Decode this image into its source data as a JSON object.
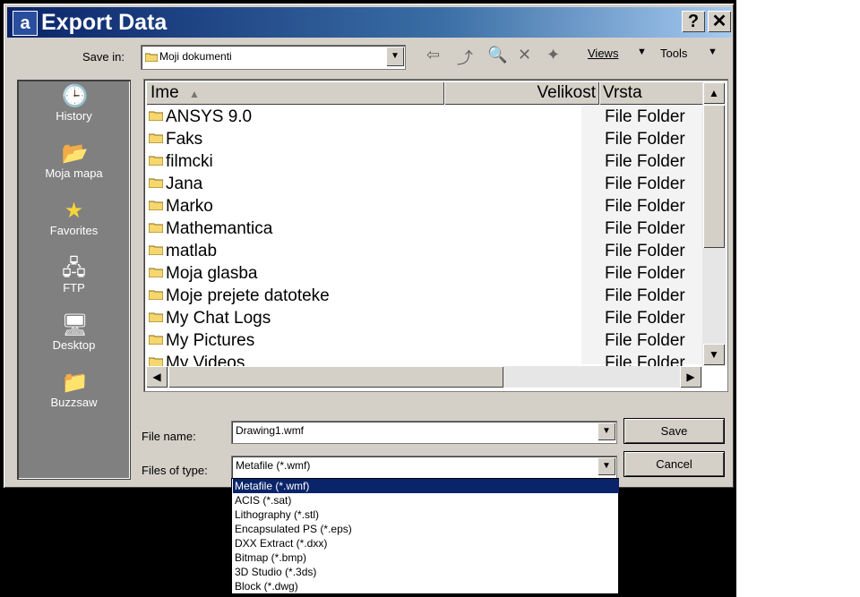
{
  "window": {
    "title": "Export Data",
    "help_label": "?",
    "close_label": "✕"
  },
  "toolbar": {
    "save_in_label": "Save in:",
    "save_in_value": "Moji dokumenti",
    "views_label": "Views",
    "tools_label": "Tools"
  },
  "places": [
    {
      "label": "History",
      "icon": "history-icon"
    },
    {
      "label": "Moja mapa",
      "icon": "folder-icon"
    },
    {
      "label": "Favorites",
      "icon": "star-icon"
    },
    {
      "label": "FTP",
      "icon": "ftp-icon"
    },
    {
      "label": "Desktop",
      "icon": "desktop-icon"
    },
    {
      "label": "Buzzsaw",
      "icon": "buzzsaw-icon"
    }
  ],
  "list": {
    "columns": {
      "name": "Ime",
      "size": "Velikost",
      "type": "Vrsta"
    },
    "rows": [
      {
        "name": "ANSYS 9.0",
        "type": "File Folder"
      },
      {
        "name": "Faks",
        "type": "File Folder"
      },
      {
        "name": "filmcki",
        "type": "File Folder"
      },
      {
        "name": "Jana",
        "type": "File Folder"
      },
      {
        "name": "Marko",
        "type": "File Folder"
      },
      {
        "name": "Mathemantica",
        "type": "File Folder"
      },
      {
        "name": "matlab",
        "type": "File Folder"
      },
      {
        "name": "Moja glasba",
        "type": "File Folder"
      },
      {
        "name": "Moje prejete datoteke",
        "type": "File Folder"
      },
      {
        "name": "My Chat Logs",
        "type": "File Folder"
      },
      {
        "name": "My Pictures",
        "type": "File Folder"
      },
      {
        "name": "My Videos",
        "type": "File Folder"
      }
    ]
  },
  "form": {
    "file_name_label": "File name:",
    "file_name_value": "Drawing1.wmf",
    "file_type_label": "Files of type:",
    "file_type_value": "Metafile (*.wmf)",
    "save_label": "Save",
    "cancel_label": "Cancel"
  },
  "file_types": [
    "Metafile (*.wmf)",
    "ACIS (*.sat)",
    "Lithography (*.stl)",
    "Encapsulated PS (*.eps)",
    "DXX Extract (*.dxx)",
    "Bitmap (*.bmp)",
    "3D Studio (*.3ds)",
    "Block (*.dwg)"
  ],
  "colors": {
    "title_start": "#0a246a",
    "selection": "#0a246a",
    "folder": "#f5d76e"
  }
}
